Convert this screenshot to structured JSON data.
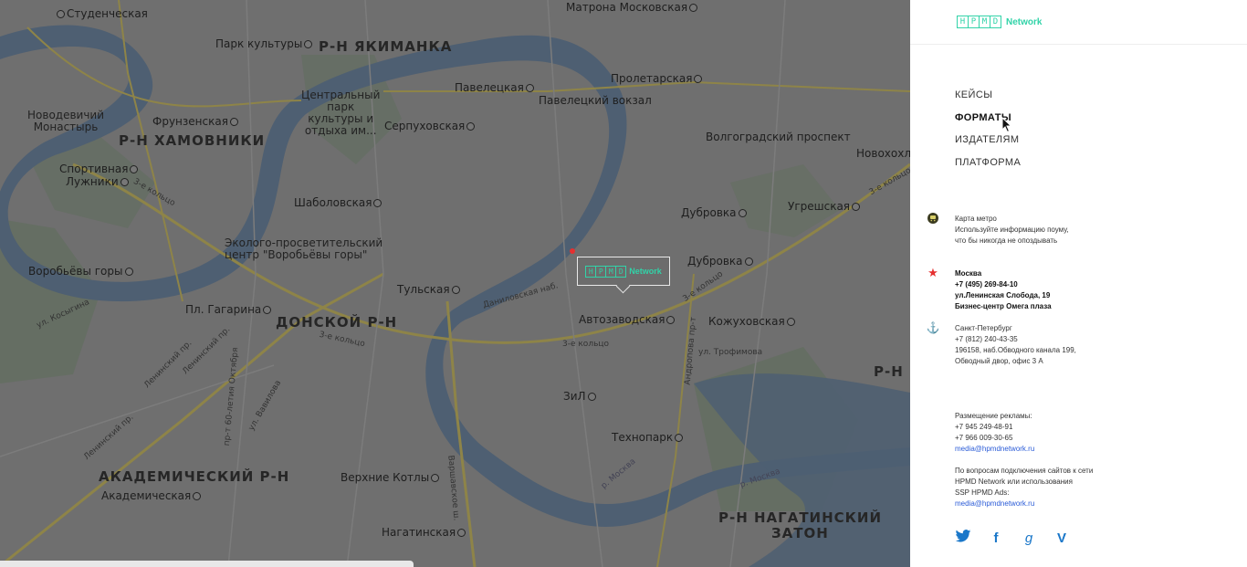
{
  "map": {
    "districts": [
      {
        "id": "yakimanka",
        "text": "Р-Н ЯКИМАНКА"
      },
      {
        "id": "khamovniki",
        "text": "Р-Н ХАМОВНИКИ"
      },
      {
        "id": "donskoy",
        "text": "ДОНСКОЙ Р-Н"
      },
      {
        "id": "akademicheskiy",
        "text": "АКАДЕМИЧЕСКИЙ Р-Н"
      },
      {
        "id": "nagatinskiy1",
        "text": "Р-Н НАГАТИНСКИЙ"
      },
      {
        "id": "nagatinskiy2",
        "text": "ЗАТОН"
      },
      {
        "id": "rn-edge",
        "text": "Р-Н"
      }
    ],
    "stations": [
      "Студенческая",
      "Парк культуры",
      "Матрона Московская",
      "Павелецкая",
      "Павелецкий вокзал",
      "Серпуховская",
      "Пролетарская",
      "Фрунзенская",
      "Волгоградский проспект",
      "Новохохл",
      "Спортивная",
      "Лужники",
      "Шаболовская",
      "Угрешская",
      "Дубровка",
      "Дубровка",
      "Воробьёвы горы",
      "Тульская",
      "Пл. Гагарина",
      "Автозаводская",
      "Кожуховская",
      "ЗиЛ",
      "Технопарк",
      "Академическая",
      "Верхние Котлы",
      "Нагатинская"
    ],
    "pois": {
      "novodevichiy": "Новодевичий\nМонастырь",
      "central_park": "Центральный\nпарк\nкультуры и\nотдыха им...",
      "eco_center": "Эколого-просветительский\nцентр \"Воробьёвы горы\""
    },
    "roads": [
      "3-е кольцо",
      "3-е кольцо",
      "3-е кольцо",
      "3-е кольцо",
      "3-е кольцо",
      "Ленинский пр.",
      "Ленинский пр.",
      "Варшавское ш.",
      "р. Москва",
      "р. Москва",
      "ул. Косыгина",
      "ул. Трофимова",
      "Даниловская наб.",
      "Андропова пр-т",
      "пр-т 60-летия Октября",
      "Ленинский пр.",
      "ул. Вавилова"
    ],
    "marker": {
      "logo_letters": [
        "Н",
        "Р",
        "М",
        "D"
      ],
      "logo_word": "Network"
    }
  },
  "panel": {
    "logo_letters": [
      "Н",
      "Р",
      "М",
      "D"
    ],
    "logo_word": "Network",
    "nav": [
      {
        "label": "КЕЙСЫ",
        "active": false
      },
      {
        "label": "ФОРМАТЫ",
        "active": true
      },
      {
        "label": "ИЗДАТЕЛЯМ",
        "active": false
      },
      {
        "label": "ПЛАТФОРМА",
        "active": false
      }
    ],
    "metro": {
      "title": "Карта метро",
      "line1": "Используйте информацию поуму,",
      "line2": "что бы никогда не опоздывать"
    },
    "moscow": {
      "city": "Москва",
      "phone": "+7 (495) 269-84-10",
      "address1": "ул.Ленинская Слобода, 19",
      "address2": "Бизнес-центр Омега плаза"
    },
    "spb": {
      "city": "Санкт-Петербург",
      "phone": "+7 (812) 240-43-35",
      "address1": "196158, наб.Обводного канала 199,",
      "address2": "Обводный двор, офис 3 А"
    },
    "ads": {
      "title": "Размещение рекламы:",
      "phone1": "+7 945 249-48-91",
      "phone2": "+7 966 009-30-65",
      "email": "media@hpmdnetwork.ru"
    },
    "connect": {
      "line1": "По вопросам подключения сайтов к сети",
      "line2": "HPMD Network или использования",
      "line3": "SSP HPMD Ads:",
      "email": "media@hpmdnetwork.ru"
    },
    "social": {
      "twitter": "🐦",
      "facebook": "f",
      "google": "g",
      "vimeo": "V"
    }
  },
  "colors": {
    "accent": "#31d3a8",
    "link": "#2a5bd7",
    "social": "#1a77c9",
    "map_bg": "#6e6e6e",
    "river": "#4e5f72"
  }
}
